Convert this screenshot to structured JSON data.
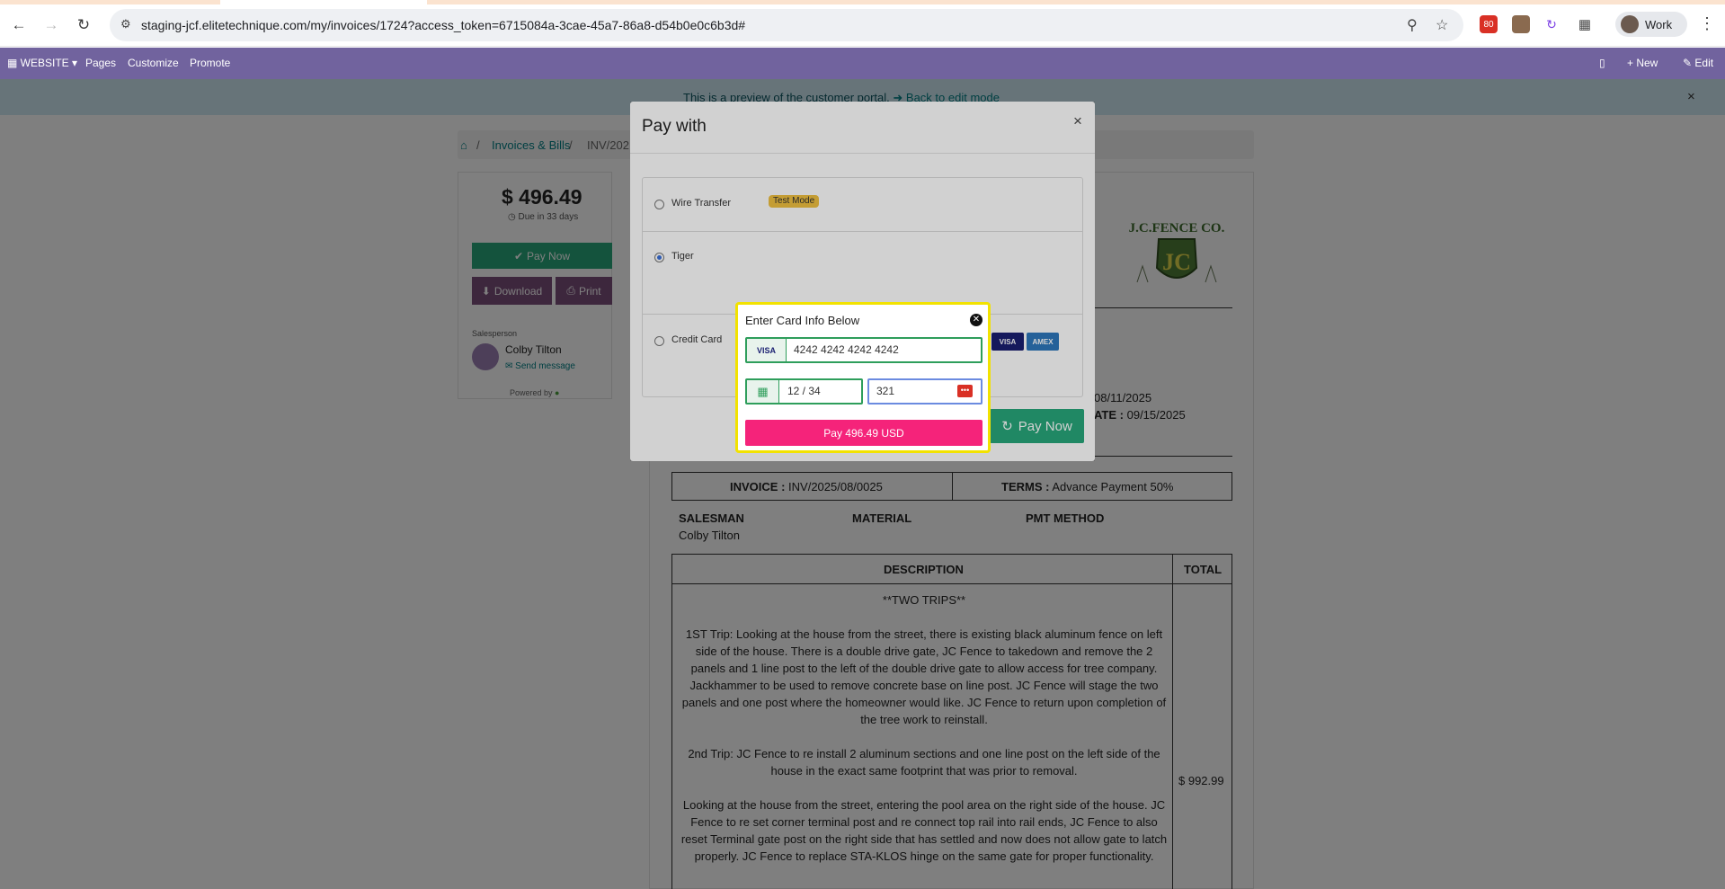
{
  "browser": {
    "url": "staging-jcf.elitetechnique.com/my/invoices/1724?access_token=6715084a-3cae-45a7-86a8-d54b0e0c6b3d#",
    "profile_label": "Work",
    "extension_badge": "80"
  },
  "website_bar": {
    "website_label": "WEBSITE",
    "items": [
      "Pages",
      "Customize",
      "Promote"
    ],
    "new_label": "New",
    "edit_label": "Edit"
  },
  "preview_banner": {
    "text": "This is a preview of the customer portal.",
    "link": "Back to edit mode"
  },
  "breadcrumb": {
    "section": "Invoices & Bills",
    "current": "INV/202"
  },
  "sidebar": {
    "amount": "$ 496.49",
    "due": "Due in 33 days",
    "pay_now": "Pay Now",
    "download": "Download",
    "print": "Print",
    "salesperson_label": "Salesperson",
    "salesperson_name": "Colby Tilton",
    "send_message": "Send message",
    "powered_by": "Powered by"
  },
  "invoice": {
    "date_1": "08/11/2025",
    "due_date_label": "ATE :",
    "due_date": "09/15/2025",
    "invoice_label": "INVOICE :",
    "invoice_no": "INV/2025/08/0025",
    "terms_label": "TERMS :",
    "terms": "Advance Payment 50%",
    "salesman_label": "SALESMAN",
    "salesman": "Colby Tilton",
    "material_label": "MATERIAL",
    "pmt_label": "PMT METHOD",
    "desc_header": "DESCRIPTION",
    "total_header": "TOTAL",
    "desc_title": "**TWO TRIPS**",
    "desc_p1": "1ST Trip: Looking at the house from the street, there is existing black aluminum fence on left side of the house. There is a double drive gate, JC Fence to takedown and remove the 2 panels and 1 line post to the left of the double drive gate to allow access for tree company. Jackhammer to be used to remove concrete base on line post. JC Fence will stage the two panels and one post where the homeowner would like. JC Fence to return upon completion of the tree work to reinstall.",
    "desc_p2": "2nd Trip: JC Fence to re install 2 aluminum sections and one line post on the left side of the house in the exact same footprint that was prior to removal.",
    "desc_p3": "Looking at the house from the street, entering the pool area on the right side of the house. JC Fence to re set corner terminal post and re connect top rail into rail ends, JC Fence to also reset Terminal gate post on the right side that has settled and now does not allow gate to latch properly. JC Fence to replace STA-KLOS hinge on the same gate for proper functionality.",
    "total": "$ 992.99",
    "logo_text": "J.C.FENCE CO.",
    "logo_mono": "JC"
  },
  "pay_modal": {
    "title": "Pay with",
    "methods": [
      {
        "label": "Wire Transfer",
        "badge": "Test Mode",
        "selected": false
      },
      {
        "label": "Tiger",
        "selected": true
      },
      {
        "label": "Credit Card",
        "selected": false
      }
    ],
    "card_logos": [
      "VISA",
      "AMEX"
    ],
    "pay_now": "Pay Now"
  },
  "card_popup": {
    "title": "Enter Card Info Below",
    "card_brand": "VISA",
    "card_number": "4242 4242 4242 4242",
    "expiry": "12 / 34",
    "cvc": "321",
    "pay_button": "Pay 496.49 USD"
  },
  "colors": {
    "odoo_bar": "#71639e",
    "primary_green": "#28a77a",
    "secondary_purple": "#7b4e7b",
    "pay_pink": "#f5237a",
    "popup_border": "#f2e200"
  }
}
